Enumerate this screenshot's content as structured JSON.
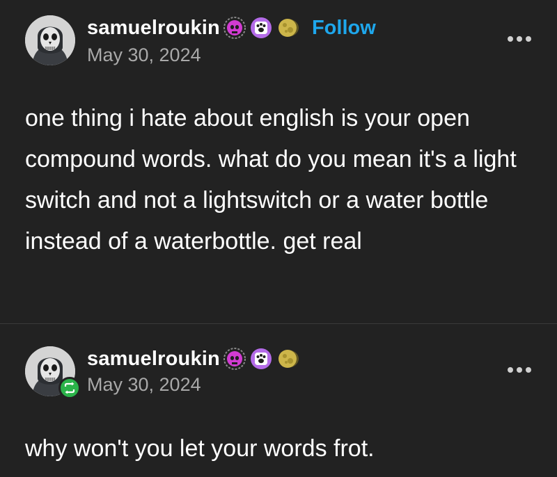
{
  "posts": [
    {
      "username": "samuelroukin",
      "badges": [
        "skull-badge-icon",
        "paw-badge-icon",
        "moon-badge-icon"
      ],
      "follow_label": "Follow",
      "date": "May 30, 2024",
      "text": "one thing i hate about english is your open compound words. what do you mean it's a light switch and not a lightswitch or a water bottle instead of a waterbottle. get real",
      "more_icon": "more-options-icon"
    },
    {
      "username": "samuelroukin",
      "badges": [
        "skull-badge-icon",
        "paw-badge-icon",
        "moon-badge-icon"
      ],
      "reblog_icon": "reblog-icon",
      "date": "May 30, 2024",
      "text": "why won't you let your words frot.",
      "more_icon": "more-options-icon"
    }
  ],
  "colors": {
    "background": "#222222",
    "text": "#ffffff",
    "secondary_text": "#a9a9a9",
    "follow": "#1ea7ec",
    "reblog": "#2bb34a"
  }
}
